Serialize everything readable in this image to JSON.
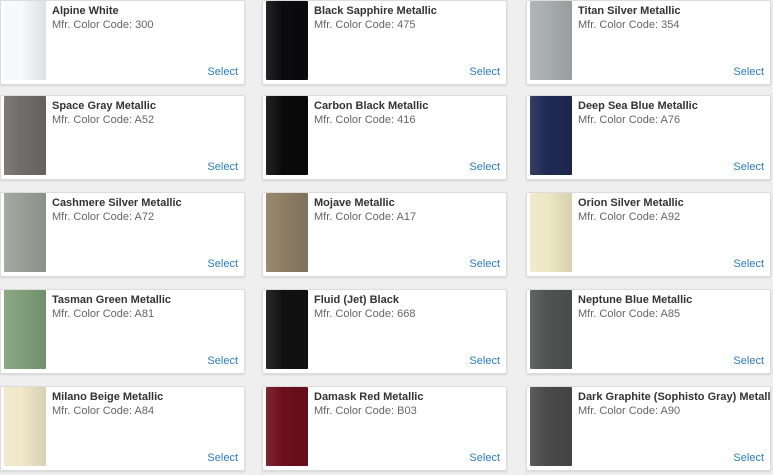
{
  "colors": [
    {
      "name": "Alpine White",
      "code": "Mfr. Color Code: 300",
      "swatch": "#f7f9fc",
      "select": "Select"
    },
    {
      "name": "Black Sapphire Metallic",
      "code": "Mfr. Color Code: 475",
      "swatch": "#0b0b0d",
      "select": "Select"
    },
    {
      "name": "Titan Silver Metallic",
      "code": "Mfr. Color Code: 354",
      "swatch": "#a8adae",
      "select": "Select"
    },
    {
      "name": "Space Gray Metallic",
      "code": "Mfr. Color Code: A52",
      "swatch": "#6e6d6b",
      "select": "Select"
    },
    {
      "name": "Carbon Black Metallic",
      "code": "Mfr. Color Code: 416",
      "swatch": "#0a0a0a",
      "select": "Select"
    },
    {
      "name": "Deep Sea Blue Metallic",
      "code": "Mfr. Color Code: A76",
      "swatch": "#1f2a55",
      "select": "Select"
    },
    {
      "name": "Cashmere Silver Metallic",
      "code": "Mfr. Color Code: A72",
      "swatch": "#9c9f98",
      "select": "Select"
    },
    {
      "name": "Mojave Metallic",
      "code": "Mfr. Color Code: A17",
      "swatch": "#8d7e64",
      "select": "Select"
    },
    {
      "name": "Orion Silver Metallic",
      "code": "Mfr. Color Code: A92",
      "swatch": "#efe8c4",
      "select": "Select"
    },
    {
      "name": "Tasman Green Metallic",
      "code": "Mfr. Color Code: A81",
      "swatch": "#7f9f79",
      "select": "Select"
    },
    {
      "name": "Fluid (Jet) Black",
      "code": "Mfr. Color Code: 668",
      "swatch": "#111111",
      "select": "Select"
    },
    {
      "name": "Neptune Blue Metallic",
      "code": "Mfr. Color Code: A85",
      "swatch": "#4f5452",
      "select": "Select"
    },
    {
      "name": "Milano Beige Metallic",
      "code": "Mfr. Color Code: A84",
      "swatch": "#f0e8c8",
      "select": "Select"
    },
    {
      "name": "Damask Red Metallic",
      "code": "Mfr. Color Code: B03",
      "swatch": "#6d0f1c",
      "select": "Select"
    },
    {
      "name": "Dark Graphite (Sophisto Gray) Metallic",
      "code": "Mfr. Color Code: A90",
      "swatch": "#4a4a4a",
      "select": "Select"
    }
  ]
}
